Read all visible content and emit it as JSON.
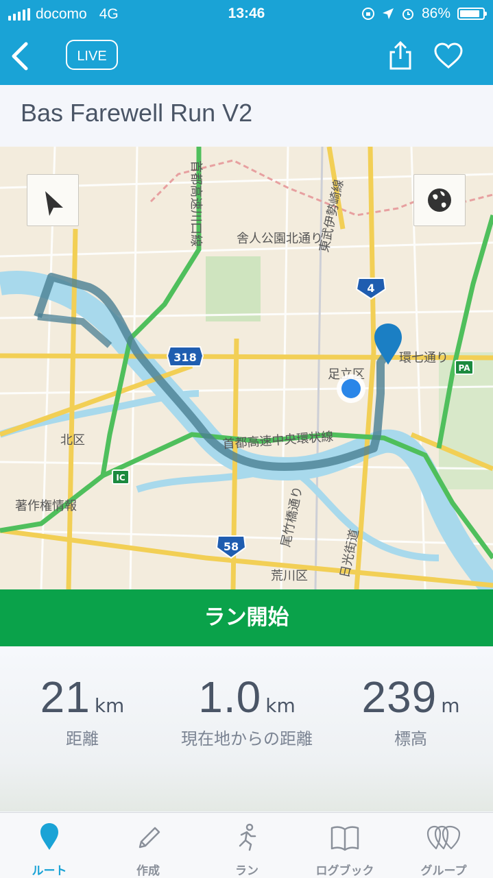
{
  "status_bar": {
    "carrier": "docomo",
    "network": "4G",
    "time": "13:46",
    "battery": "86%",
    "battery_level": 0.86
  },
  "nav": {
    "live_label": "LIVE",
    "back_icon": "back-chevron-icon",
    "share_icon": "share-icon",
    "favorite_icon": "heart-icon"
  },
  "route": {
    "title": "Bas Farewell Run V2"
  },
  "map": {
    "labels": {
      "area_adachi": "足立区",
      "area_kita": "北区",
      "area_arakawa": "荒川区",
      "park_road": "舎人公園北通り",
      "loop7": "環七通り",
      "expressway": "首都高速中央環状線",
      "expressway_kawaguchi": "首都高速川口線",
      "tobu_line": "東武伊勢崎線",
      "nikko_kaido": "日光街道",
      "odaketachi": "尾竹橋通り",
      "copyright": "著作権情報",
      "pa": "PA",
      "ic": "IC",
      "route_318": "318",
      "route_4": "4",
      "route_58": "58"
    },
    "locate_icon": "location-arrow-icon",
    "globe_icon": "globe-icon"
  },
  "start_button": "ラン開始",
  "stats": [
    {
      "value": "21",
      "unit": "km",
      "label": "距離"
    },
    {
      "value": "1.0",
      "unit": "km",
      "label": "現在地からの距離"
    },
    {
      "value": "239",
      "unit": "m",
      "label": "標高"
    }
  ],
  "tabs": [
    {
      "label": "ルート",
      "icon": "map-pin-icon",
      "active": true
    },
    {
      "label": "作成",
      "icon": "pencil-icon",
      "active": false
    },
    {
      "label": "ラン",
      "icon": "runner-icon",
      "active": false
    },
    {
      "label": "ログブック",
      "icon": "book-icon",
      "active": false
    },
    {
      "label": "グループ",
      "icon": "group-icon",
      "active": false
    }
  ],
  "colors": {
    "accent": "#1aa3d6",
    "start": "#0aa24a",
    "route_line": "#4a7f93",
    "river": "#a8d9ec",
    "expressway": "#4fbf5c",
    "road_yellow": "#f2cf55"
  }
}
